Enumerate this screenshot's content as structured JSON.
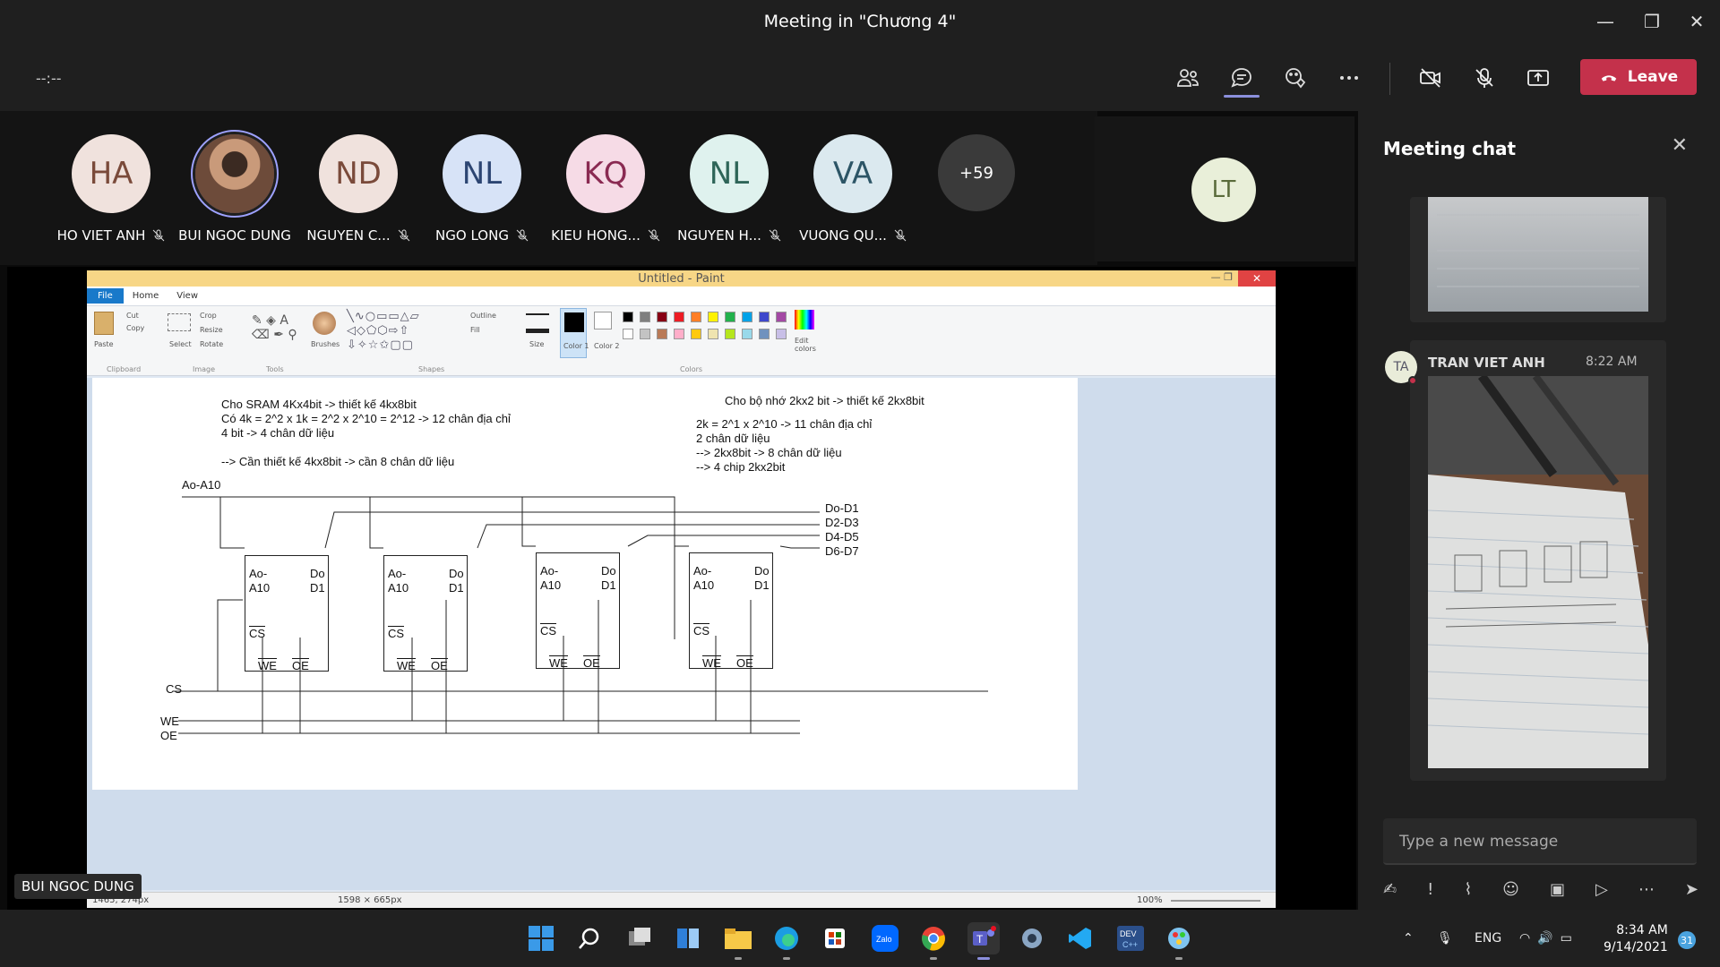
{
  "window": {
    "title": "Meeting in \"Chương 4\""
  },
  "toolbar": {
    "timer": "--:--",
    "leave_label": "Leave"
  },
  "participants": [
    {
      "initials": "HA",
      "name": "HO VIET ANH",
      "bg": "#f0e2dd",
      "fg": "#7a4a3a"
    },
    {
      "initials": "",
      "name": "BUI NGOC DUNG",
      "bg": "#b07a55",
      "fg": "#fff"
    },
    {
      "initials": "ND",
      "name": "NGUYEN C...",
      "bg": "#f0e2dd",
      "fg": "#7a4a3a"
    },
    {
      "initials": "NL",
      "name": "NGO LONG",
      "bg": "#d7e3f7",
      "fg": "#2c4572"
    },
    {
      "initials": "KQ",
      "name": "KIEU HONG...",
      "bg": "#f6dbe6",
      "fg": "#8a2a52"
    },
    {
      "initials": "NL",
      "name": "NGUYEN H...",
      "bg": "#dff2ee",
      "fg": "#2e6558"
    },
    {
      "initials": "VA",
      "name": "VUONG QU...",
      "bg": "#dbe9ef",
      "fg": "#2c5566"
    },
    {
      "initials": "+59",
      "name": "",
      "bg": "#3a3a3a",
      "fg": "#fff"
    }
  ],
  "lt_avatar": "LT",
  "speaker_label": "BUI NGOC DUNG",
  "paint": {
    "title": "Untitled - Paint",
    "tabs": [
      "File",
      "Home",
      "View"
    ],
    "groups": [
      "Clipboard",
      "Image",
      "Tools",
      "Shapes",
      "Colors"
    ],
    "labels": {
      "paste": "Paste",
      "cut": "Cut",
      "copy": "Copy",
      "select": "Select",
      "crop": "Crop",
      "resize": "Resize",
      "rotate": "Rotate",
      "brushes": "Brushes",
      "outline": "Outline",
      "fill": "Fill",
      "size": "Size",
      "color1": "Color 1",
      "color2": "Color 2",
      "edit_colors": "Edit colors"
    },
    "palette": [
      "#000000",
      "#7f7f7f",
      "#880015",
      "#ed1c24",
      "#ff7f27",
      "#fff200",
      "#22b14c",
      "#00a2e8",
      "#3f48cc",
      "#a349a4",
      "#ffffff",
      "#c3c3c3",
      "#b97a57",
      "#ffaec9",
      "#ffc90e",
      "#efe4b0",
      "#b5e61d",
      "#99d9ea",
      "#7092be",
      "#c8bfe7"
    ],
    "status": {
      "pos": "1465, 274px",
      "size": "1598 × 665px",
      "zoom": "100%"
    },
    "canvas_text": {
      "l1": "Cho SRAM 4Kx4bit -> thiết kế 4kx8bit",
      "l2": "Có 4k = 2^2 x 1k = 2^2 x 2^10 = 2^12 -> 12 chân địa chỉ",
      "l3": "4 bit -> 4 chân dữ liệu",
      "l4": "--> Cần thiết kế 4kx8bit -> cần 8 chân dữ liệu",
      "r1": "Cho bộ nhớ 2kx2 bit -> thiết kế 2kx8bit",
      "r2": "2k = 2^1 x 2^10 -> 11 chân địa chỉ",
      "r3": "2 chân dữ liệu",
      "r4": "--> 2kx8bit -> 8 chân dữ liệu",
      "r5": "--> 4 chip 2kx2bit",
      "addr": "Ao-A10",
      "d01": "Do-D1",
      "d23": "D2-D3",
      "d45": "D4-D5",
      "d67": "D6-D7",
      "cs": "CS",
      "we": "WE",
      "oe": "OE",
      "chip_a": "Ao-",
      "chip_a2": "A10",
      "chip_do": "Do",
      "chip_d1": "D1",
      "chip_cs": "CS",
      "chip_we": "WE",
      "chip_oe": "OE"
    }
  },
  "chat": {
    "title": "Meeting chat",
    "sender": "TRAN VIET ANH",
    "sender_initials": "TA",
    "time": "8:22 AM",
    "placeholder": "Type a new message"
  },
  "taskbar": {
    "lang": "ENG",
    "time": "8:34 AM",
    "date": "9/14/2021",
    "badge": "31"
  }
}
